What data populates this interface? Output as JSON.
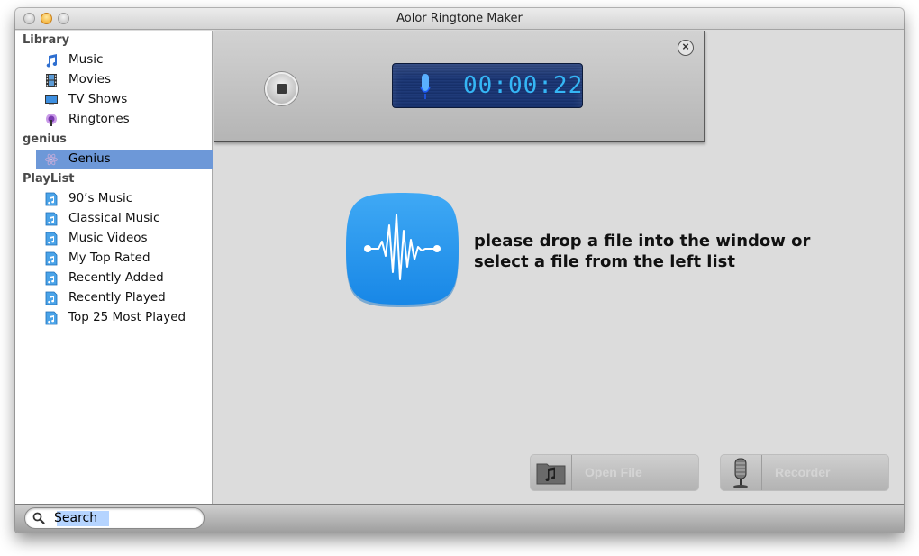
{
  "window": {
    "title": "Aolor Ringtone Maker"
  },
  "sidebar": {
    "sections": [
      {
        "header": "Library",
        "items": [
          {
            "label": "Music",
            "icon": "music-note-icon"
          },
          {
            "label": "Movies",
            "icon": "film-icon"
          },
          {
            "label": "TV Shows",
            "icon": "tv-icon"
          },
          {
            "label": "Ringtones",
            "icon": "ringtone-icon"
          }
        ]
      },
      {
        "header": "genius",
        "items": [
          {
            "label": "Genius",
            "icon": "genius-atom-icon",
            "selected": true
          }
        ]
      },
      {
        "header": "PlayList",
        "items": [
          {
            "label": "90’s Music",
            "icon": "playlist-icon"
          },
          {
            "label": "Classical Music",
            "icon": "playlist-icon"
          },
          {
            "label": "Music Videos",
            "icon": "playlist-icon"
          },
          {
            "label": "My Top Rated",
            "icon": "playlist-icon"
          },
          {
            "label": "Recently Added",
            "icon": "playlist-icon"
          },
          {
            "label": "Recently Played",
            "icon": "playlist-icon"
          },
          {
            "label": "Top 25 Most Played",
            "icon": "playlist-icon"
          }
        ]
      }
    ]
  },
  "recorder": {
    "elapsed_time": "00:00:22",
    "stop_icon": "stop-icon",
    "close_icon": "close-circle-icon",
    "mic_icon": "microphone-icon"
  },
  "main": {
    "drop_message_line1": "please drop a file into the window or",
    "drop_message_line2": "select a file from the left list",
    "open_file_label": "Open File",
    "recorder_label": "Recorder"
  },
  "search": {
    "value": "Search"
  },
  "colors": {
    "selection": "#6d98d8",
    "lcd_text": "#35b6f5",
    "app_icon": "#2a9af0"
  }
}
